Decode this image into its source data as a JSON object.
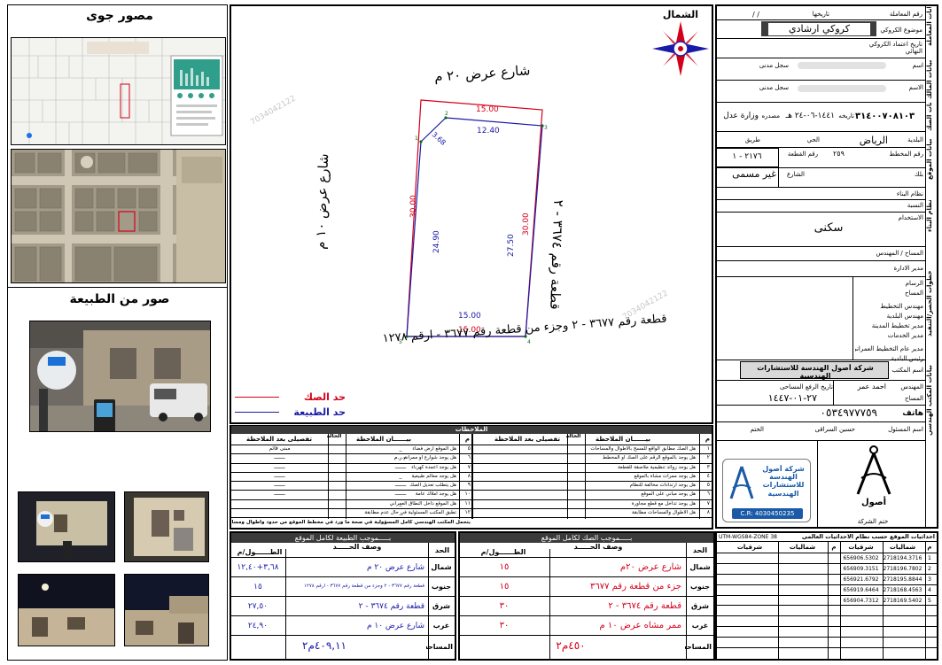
{
  "panel_titles": {
    "aerial": "مصور جوى",
    "nature_photos": "صور من الطبيعة"
  },
  "north_label": "الشمال",
  "sketch": {
    "street_north": "شارع عرض ٢٠ م",
    "street_west": "شارع عرض ١٠ م",
    "plot_east": "قطعة رقم ٣٦٧٤ - ٢",
    "plot_south_line1": "قطعة رقم ٣٦٧٧ - ٢ وجزء من قطعة رقم ٣٦٧٧ - ارقم ١٢٧٨",
    "dims_red": {
      "north": "15.00",
      "west": "30.00",
      "east": "30.00",
      "south": "15.00"
    },
    "dims_blue": {
      "north": "12.40",
      "west": "24.90",
      "east": "27.50",
      "south": "15.00",
      "chamfer": "3.68"
    },
    "legend": [
      {
        "label": "حد الصك",
        "color": "#d4001a"
      },
      {
        "label": "حد الطبيعة",
        "color": "#1a1aa8"
      }
    ]
  },
  "right_panel": {
    "sections": [
      "بيانات المعاملة",
      "بيانات المالك",
      "بيانات الصك",
      "بيانات الموقع",
      "نظام البناء",
      "خطوات الحصر/التنفيذ",
      "بيانات المكتب الهندسي"
    ],
    "rows": {
      "txn_no": "رقم المعاملة",
      "date_label": "تاريخها",
      "date_val": "/       /",
      "subject_label": "موضوع الكروكي",
      "subject_val": "كروكي ارشادي",
      "approval_label": "تاريخ اعتماد الكروكي النهائي",
      "name_label": "اسم",
      "civil_label": "سجل مدنى",
      "name2_label": "الاسم",
      "civil2_label": "سجل مدنى",
      "deed_no": "٣١٤٠٠٧٠٨١٠٣",
      "deed_date_label": "تاريخه",
      "deed_date": "١٤٤١-٠٦-٢٤ هـ",
      "deed_source_label": "مصدره",
      "deed_source": "وزارة عدل",
      "municipality_label": "البلدية",
      "municipality": "الرياض",
      "district_label": "الحي",
      "road_label": "طريق",
      "plan_label": "رقم المخطط",
      "plan": "٢٥٩",
      "plot_label": "رقم القطعة",
      "plot": "٢١٧٦ - ١",
      "block_label": "بلك",
      "street_label": "الشارع",
      "street": "غير مسمى",
      "building_label": "نظام البناء",
      "ratio_label": "النسبة",
      "usage_label": "الاستخدام",
      "usage": "سكنى",
      "surveyor_label": "المساح / المهندس",
      "manager_label": "مدير الادارة",
      "steps": [
        "الرسام",
        "المساح",
        "مهندس التخطيط",
        "مهندس البلدية",
        "مدير تخطيط المدينة",
        "مدير الخدمات",
        "مدير عام التخطيط العمراني",
        "رئيس البلدية"
      ],
      "office_label": "اسم المكتب",
      "office": "شركة أصول الهندسة للاستشارات الهندسية",
      "engineer_label": "المهندس",
      "engineer": "احمد عمر",
      "surveyor_label2": "المساح",
      "surveyor_name": "",
      "visit_label": "تاريخ الرفع المساحى",
      "visit_date": "٢٧-٠١-١٤٤٧",
      "phone_label": "هاتف",
      "phone": "٠٥٣٤٩٧٧٧٥٩",
      "responsible_label": "اسم المسئول",
      "responsible": "حسين السراقى",
      "stamp_label": "الختم",
      "company_sign": "ختم الشركة",
      "cr": "C.R: 4030450235",
      "company_name": "شركة أصول الهندسة للاستشارات الهندسية"
    }
  },
  "notes": {
    "title": "الملاحظات",
    "col_no": "م",
    "col_note": "بيــــــان الملاحظة",
    "col_status": "الحالة",
    "col_yes": "نعم",
    "col_no2": "لا",
    "col_detail": "تفصيلى بعد الملاحظة",
    "right_items": [
      "هل الصك مطابق الواقع للمسح بالاطوال والمساحات",
      "هل يوجد بالموقع الرقم على الصك او المخطط",
      "هل يوجد زوائد تنظيمية ملاصقة للقطعة",
      "هل يوجد ممرات مشاة بالموقع",
      "هل يوجد ارتدادات مخالفة للنظام",
      "هل يوجد مباني على الموقع",
      "هل يوجد تداخل مع قطع مجاورة",
      "هل الأطوال والمساحات مطابقة"
    ],
    "left_items": [
      "هل الموقع ارض فضاء",
      "هل يوجد شوارع او ممرات",
      "هل يوجد اعمدة كهرباء",
      "هل يوجد معالم طبيعية",
      "هل يتطلب تعديل الصك",
      "هل يوجد املاك عامة",
      "هل الموقع داخل النطاق العمراني",
      "تطبق المكتب المسئولية في حال عدم مطابقة"
    ],
    "detail_right": [
      "_",
      "م.ر.م",
      "ـــــــ",
      "_",
      "ـــــــ",
      "ـــــــ",
      "_",
      "_"
    ],
    "detail_left": [
      "مبنى قائم",
      "ـــــــ",
      "ـــــــ",
      "ـــــــ",
      "ـــــــ",
      "ـــــــ",
      "",
      ""
    ],
    "footer": "يتحمل المكتب الهندسي كامل المسؤولية في صحة ما ورد في مخطط الموقع من حدود وأطوال ومساحة وإحداثيات"
  },
  "deed_table": {
    "title": "بـــــموجب الصك لكامل الموقع",
    "h_side": "الحد",
    "h_desc": "وصف الحـــــد",
    "h_len": "الطــــــول/م",
    "rows": [
      {
        "side": "شمال",
        "desc": "شارع عرض ٢٠م",
        "len": "١٥"
      },
      {
        "side": "جنوب",
        "desc": "جزء من قطعة رقم ٣٦٧٧",
        "len": "١٥"
      },
      {
        "side": "شرق",
        "desc": "قطعة رقم ٣٦٧٤ - ٢",
        "len": "٣٠"
      },
      {
        "side": "غرب",
        "desc": "ممر مشاه عرض ١٠ م",
        "len": "٣٠"
      }
    ],
    "area_label": "المساحه",
    "area": "٤٥٠م٢"
  },
  "nature_table": {
    "title": "بـــــموجب الطبيعة لكامل الموقع",
    "h_side": "الحد",
    "h_desc": "وصف الحـــــد",
    "h_len": "الطــــــول/م",
    "rows": [
      {
        "side": "شمال",
        "desc": "شارع عرض ٢٠ م",
        "len": "٣,٦٨+١٢,٤٠"
      },
      {
        "side": "جنوب",
        "desc": "قطعة رقم ٣٦٧٧ - ٢ وجزء من قطعة رقم ٣٦٧٧ - ارقم ١٢٧٨",
        "len": "١٥"
      },
      {
        "side": "شرق",
        "desc": "قطعة رقم ٣٦٧٤ - ٢",
        "len": "٢٧,٥٠"
      },
      {
        "side": "غرب",
        "desc": "شارع عرض ١٠ م",
        "len": "٢٤,٩٠"
      }
    ],
    "area_label": "المساحه",
    "area": "٤٠٩,١١م٢"
  },
  "coords": {
    "title": "احداثيات الموقع حسب نظام الاحداثيات العالمى",
    "utm": "UTM-WGS84-ZONE 38",
    "h_no": "م",
    "h_east": "شرقيات",
    "h_north": "شماليات",
    "rows": [
      {
        "no": "1",
        "east": "656906.5302",
        "north": "2718194.3716"
      },
      {
        "no": "2",
        "east": "656909.3151",
        "north": "2718196.7802"
      },
      {
        "no": "3",
        "east": "656921.6792",
        "north": "2718195.8844"
      },
      {
        "no": "4",
        "east": "656919.6464",
        "north": "2718168.4563"
      },
      {
        "no": "5",
        "east": "656904.7312",
        "north": "2718169.5402"
      }
    ]
  },
  "watermark": "7034042122",
  "colors": {
    "red": "#d4001a",
    "blue": "#1a1aa8",
    "green": "#0a6b1a",
    "dark": "#3a3a3a"
  }
}
